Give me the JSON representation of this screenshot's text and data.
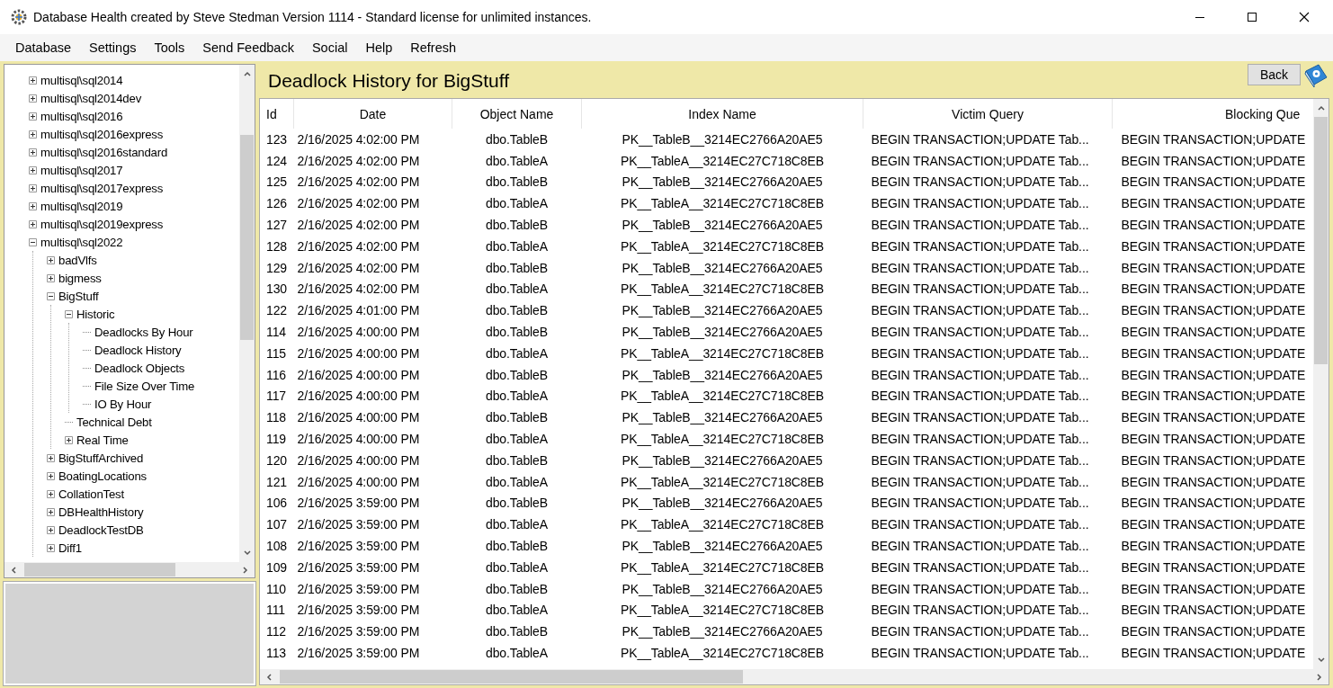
{
  "window": {
    "title": "Database Health created by Steve Stedman Version 1114 - Standard license for unlimited instances."
  },
  "menu": [
    {
      "label": "Database"
    },
    {
      "label": "Settings"
    },
    {
      "label": "Tools"
    },
    {
      "label": "Send Feedback"
    },
    {
      "label": "Social"
    },
    {
      "label": "Help"
    },
    {
      "label": "Refresh"
    }
  ],
  "tree": [
    {
      "label": "multisql\\sql2014",
      "kind": "node",
      "expanded": false
    },
    {
      "label": "multisql\\sql2014dev",
      "kind": "node",
      "expanded": false
    },
    {
      "label": "multisql\\sql2016",
      "kind": "node",
      "expanded": false
    },
    {
      "label": "multisql\\sql2016express",
      "kind": "node",
      "expanded": false
    },
    {
      "label": "multisql\\sql2016standard",
      "kind": "node",
      "expanded": false
    },
    {
      "label": "multisql\\sql2017",
      "kind": "node",
      "expanded": false
    },
    {
      "label": "multisql\\sql2017express",
      "kind": "node",
      "expanded": false
    },
    {
      "label": "multisql\\sql2019",
      "kind": "node",
      "expanded": false
    },
    {
      "label": "multisql\\sql2019express",
      "kind": "node",
      "expanded": false
    },
    {
      "label": "multisql\\sql2022",
      "kind": "node",
      "expanded": true,
      "children": [
        {
          "label": "badVlfs",
          "kind": "node",
          "expanded": false
        },
        {
          "label": "bigmess",
          "kind": "node",
          "expanded": false
        },
        {
          "label": "BigStuff",
          "kind": "node",
          "expanded": true,
          "children": [
            {
              "label": "Historic",
              "kind": "node",
              "expanded": true,
              "children": [
                {
                  "label": "Deadlocks By Hour",
                  "kind": "leaf"
                },
                {
                  "label": "Deadlock History",
                  "kind": "leaf"
                },
                {
                  "label": "Deadlock Objects",
                  "kind": "leaf"
                },
                {
                  "label": "File Size Over Time",
                  "kind": "leaf"
                },
                {
                  "label": "IO By Hour",
                  "kind": "leaf"
                }
              ]
            },
            {
              "label": "Technical Debt",
              "kind": "leaf"
            },
            {
              "label": "Real Time",
              "kind": "node",
              "expanded": false
            }
          ]
        },
        {
          "label": "BigStuffArchived",
          "kind": "node",
          "expanded": false
        },
        {
          "label": "BoatingLocations",
          "kind": "node",
          "expanded": false
        },
        {
          "label": "CollationTest",
          "kind": "node",
          "expanded": false
        },
        {
          "label": "DBHealthHistory",
          "kind": "node",
          "expanded": false
        },
        {
          "label": "DeadlockTestDB",
          "kind": "node",
          "expanded": false
        },
        {
          "label": "Diff1",
          "kind": "node",
          "expanded": false
        }
      ]
    }
  ],
  "report": {
    "title": "Deadlock History for BigStuff",
    "back_button": "Back"
  },
  "table": {
    "columns": [
      "Id",
      "Date",
      "Object Name",
      "Index Name",
      "Victim Query",
      "Blocking Que"
    ],
    "rows": [
      [
        "123",
        "2/16/2025 4:02:00 PM",
        "dbo.TableB",
        "PK__TableB__3214EC2766A20AE5",
        "BEGIN TRANSACTION;UPDATE Tab...",
        "BEGIN TRANSACTION;UPDATE"
      ],
      [
        "124",
        "2/16/2025 4:02:00 PM",
        "dbo.TableA",
        "PK__TableA__3214EC27C718C8EB",
        "BEGIN TRANSACTION;UPDATE Tab...",
        "BEGIN TRANSACTION;UPDATE"
      ],
      [
        "125",
        "2/16/2025 4:02:00 PM",
        "dbo.TableB",
        "PK__TableB__3214EC2766A20AE5",
        "BEGIN TRANSACTION;UPDATE Tab...",
        "BEGIN TRANSACTION;UPDATE"
      ],
      [
        "126",
        "2/16/2025 4:02:00 PM",
        "dbo.TableA",
        "PK__TableA__3214EC27C718C8EB",
        "BEGIN TRANSACTION;UPDATE Tab...",
        "BEGIN TRANSACTION;UPDATE"
      ],
      [
        "127",
        "2/16/2025 4:02:00 PM",
        "dbo.TableB",
        "PK__TableB__3214EC2766A20AE5",
        "BEGIN TRANSACTION;UPDATE Tab...",
        "BEGIN TRANSACTION;UPDATE"
      ],
      [
        "128",
        "2/16/2025 4:02:00 PM",
        "dbo.TableA",
        "PK__TableA__3214EC27C718C8EB",
        "BEGIN TRANSACTION;UPDATE Tab...",
        "BEGIN TRANSACTION;UPDATE"
      ],
      [
        "129",
        "2/16/2025 4:02:00 PM",
        "dbo.TableB",
        "PK__TableB__3214EC2766A20AE5",
        "BEGIN TRANSACTION;UPDATE Tab...",
        "BEGIN TRANSACTION;UPDATE"
      ],
      [
        "130",
        "2/16/2025 4:02:00 PM",
        "dbo.TableA",
        "PK__TableA__3214EC27C718C8EB",
        "BEGIN TRANSACTION;UPDATE Tab...",
        "BEGIN TRANSACTION;UPDATE"
      ],
      [
        "122",
        "2/16/2025 4:01:00 PM",
        "dbo.TableB",
        "PK__TableB__3214EC2766A20AE5",
        "BEGIN TRANSACTION;UPDATE Tab...",
        "BEGIN TRANSACTION;UPDATE"
      ],
      [
        "114",
        "2/16/2025 4:00:00 PM",
        "dbo.TableB",
        "PK__TableB__3214EC2766A20AE5",
        "BEGIN TRANSACTION;UPDATE Tab...",
        "BEGIN TRANSACTION;UPDATE"
      ],
      [
        "115",
        "2/16/2025 4:00:00 PM",
        "dbo.TableA",
        "PK__TableA__3214EC27C718C8EB",
        "BEGIN TRANSACTION;UPDATE Tab...",
        "BEGIN TRANSACTION;UPDATE"
      ],
      [
        "116",
        "2/16/2025 4:00:00 PM",
        "dbo.TableB",
        "PK__TableB__3214EC2766A20AE5",
        "BEGIN TRANSACTION;UPDATE Tab...",
        "BEGIN TRANSACTION;UPDATE"
      ],
      [
        "117",
        "2/16/2025 4:00:00 PM",
        "dbo.TableA",
        "PK__TableA__3214EC27C718C8EB",
        "BEGIN TRANSACTION;UPDATE Tab...",
        "BEGIN TRANSACTION;UPDATE"
      ],
      [
        "118",
        "2/16/2025 4:00:00 PM",
        "dbo.TableB",
        "PK__TableB__3214EC2766A20AE5",
        "BEGIN TRANSACTION;UPDATE Tab...",
        "BEGIN TRANSACTION;UPDATE"
      ],
      [
        "119",
        "2/16/2025 4:00:00 PM",
        "dbo.TableA",
        "PK__TableA__3214EC27C718C8EB",
        "BEGIN TRANSACTION;UPDATE Tab...",
        "BEGIN TRANSACTION;UPDATE"
      ],
      [
        "120",
        "2/16/2025 4:00:00 PM",
        "dbo.TableB",
        "PK__TableB__3214EC2766A20AE5",
        "BEGIN TRANSACTION;UPDATE Tab...",
        "BEGIN TRANSACTION;UPDATE"
      ],
      [
        "121",
        "2/16/2025 4:00:00 PM",
        "dbo.TableA",
        "PK__TableA__3214EC27C718C8EB",
        "BEGIN TRANSACTION;UPDATE Tab...",
        "BEGIN TRANSACTION;UPDATE"
      ],
      [
        "106",
        "2/16/2025 3:59:00 PM",
        "dbo.TableB",
        "PK__TableB__3214EC2766A20AE5",
        "BEGIN TRANSACTION;UPDATE Tab...",
        "BEGIN TRANSACTION;UPDATE"
      ],
      [
        "107",
        "2/16/2025 3:59:00 PM",
        "dbo.TableA",
        "PK__TableA__3214EC27C718C8EB",
        "BEGIN TRANSACTION;UPDATE Tab...",
        "BEGIN TRANSACTION;UPDATE"
      ],
      [
        "108",
        "2/16/2025 3:59:00 PM",
        "dbo.TableB",
        "PK__TableB__3214EC2766A20AE5",
        "BEGIN TRANSACTION;UPDATE Tab...",
        "BEGIN TRANSACTION;UPDATE"
      ],
      [
        "109",
        "2/16/2025 3:59:00 PM",
        "dbo.TableA",
        "PK__TableA__3214EC27C718C8EB",
        "BEGIN TRANSACTION;UPDATE Tab...",
        "BEGIN TRANSACTION;UPDATE"
      ],
      [
        "110",
        "2/16/2025 3:59:00 PM",
        "dbo.TableB",
        "PK__TableB__3214EC2766A20AE5",
        "BEGIN TRANSACTION;UPDATE Tab...",
        "BEGIN TRANSACTION;UPDATE"
      ],
      [
        "111",
        "2/16/2025 3:59:00 PM",
        "dbo.TableA",
        "PK__TableA__3214EC27C718C8EB",
        "BEGIN TRANSACTION;UPDATE Tab...",
        "BEGIN TRANSACTION;UPDATE"
      ],
      [
        "112",
        "2/16/2025 3:59:00 PM",
        "dbo.TableB",
        "PK__TableB__3214EC2766A20AE5",
        "BEGIN TRANSACTION;UPDATE Tab...",
        "BEGIN TRANSACTION;UPDATE"
      ],
      [
        "113",
        "2/16/2025 3:59:00 PM",
        "dbo.TableA",
        "PK__TableA__3214EC27C718C8EB",
        "BEGIN TRANSACTION;UPDATE Tab...",
        "BEGIN TRANSACTION;UPDATE"
      ]
    ]
  }
}
